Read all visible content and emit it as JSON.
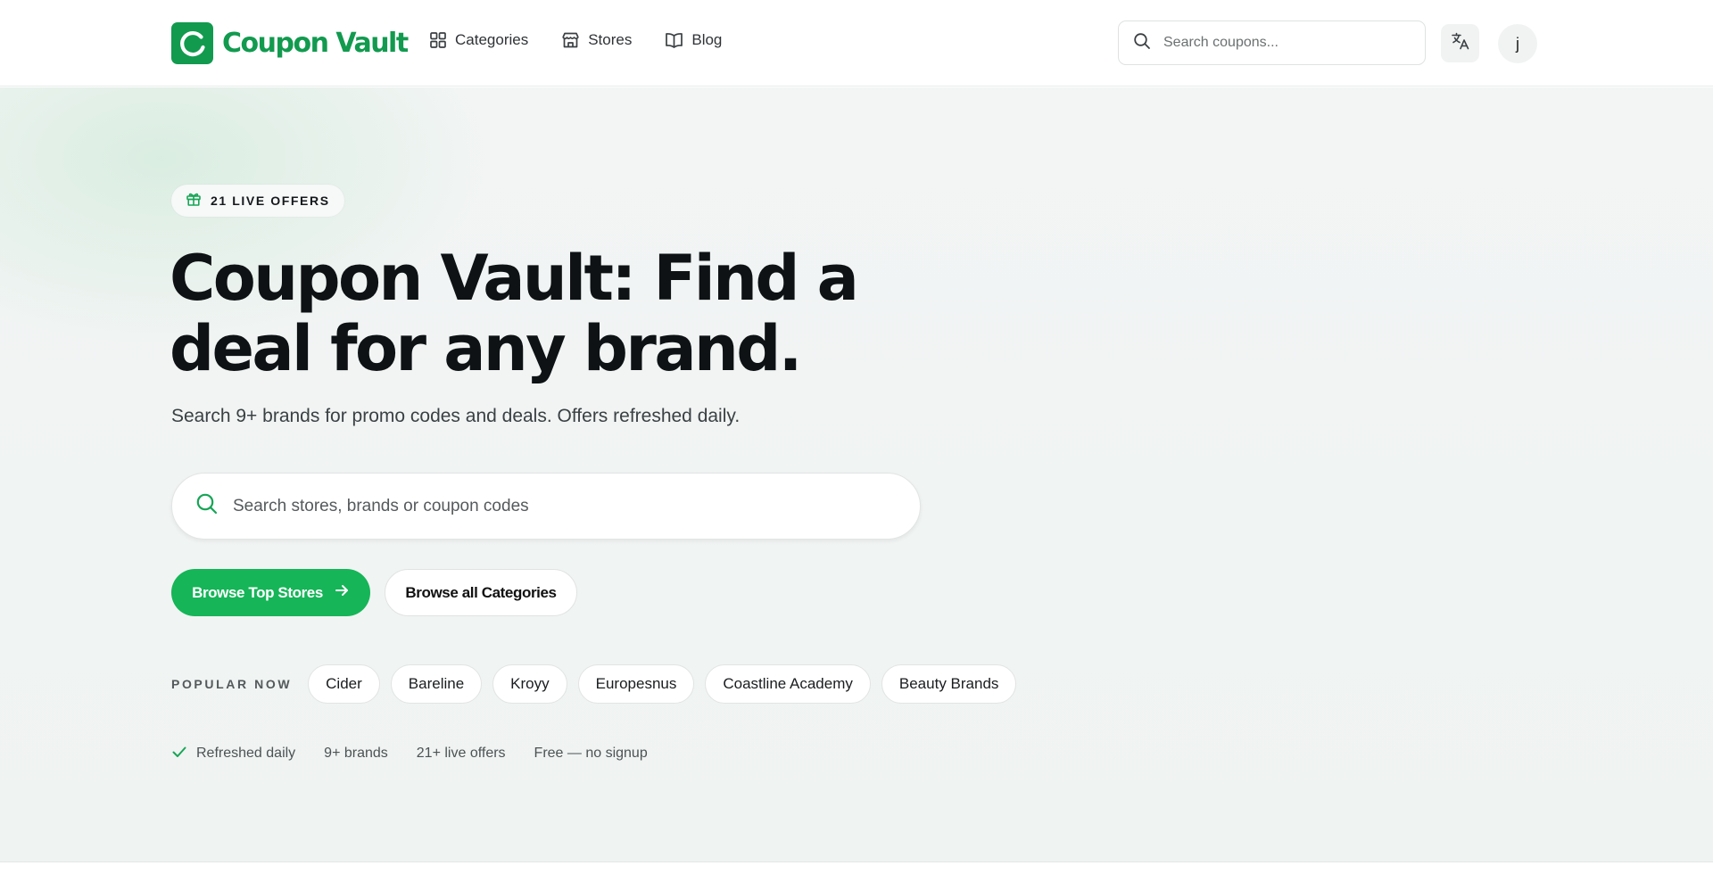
{
  "header": {
    "logo_text": "Coupon Vault",
    "nav": [
      {
        "label": "Categories",
        "icon": "grid-icon"
      },
      {
        "label": "Stores",
        "icon": "store-icon"
      },
      {
        "label": "Blog",
        "icon": "book-icon"
      }
    ],
    "search_placeholder": "Search coupons...",
    "translate_icon": "translate-icon",
    "avatar_initial": "j"
  },
  "hero": {
    "badge": "21 LIVE OFFERS",
    "headline": "Coupon Vault: Find a deal for any brand.",
    "subheadline": "Search 9+ brands for promo codes and deals. Offers refreshed daily.",
    "search_placeholder": "Search stores, brands or coupon codes",
    "primary_button": "Browse Top Stores",
    "secondary_button": "Browse all Categories",
    "popular_label": "POPULAR NOW",
    "popular_chips": [
      "Cider",
      "Bareline",
      "Kroyy",
      "Europesnus",
      "Coastline Academy",
      "Beauty Brands"
    ],
    "stats": [
      "Refreshed daily",
      "9+ brands",
      "21+ live offers",
      "Free — no signup"
    ]
  },
  "colors": {
    "brand_green": "#129a4f",
    "button_green": "#15b558",
    "hero_background": "#eff3f2"
  }
}
